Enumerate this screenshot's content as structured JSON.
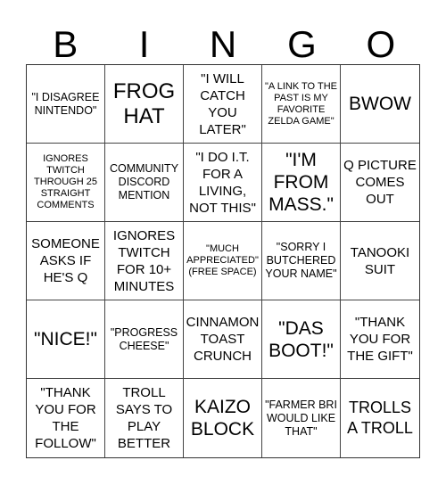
{
  "header": {
    "letters": [
      "B",
      "I",
      "N",
      "G",
      "O"
    ]
  },
  "cells": [
    {
      "text": "\"I DISAGREE NINTENDO\"",
      "size": "s2"
    },
    {
      "text": "FROG HAT",
      "size": "s6"
    },
    {
      "text": "\"I WILL CATCH YOU LATER\"",
      "size": "s3"
    },
    {
      "text": "\"A LINK TO THE PAST IS MY FAVORITE ZELDA GAME\"",
      "size": "s1"
    },
    {
      "text": "BWOW",
      "size": "s5"
    },
    {
      "text": "IGNORES TWITCH THROUGH 25 STRAIGHT COMMENTS",
      "size": "s1"
    },
    {
      "text": "COMMUNITY DISCORD MENTION",
      "size": "s2"
    },
    {
      "text": "\"I DO I.T. FOR A LIVING, NOT THIS\"",
      "size": "s3"
    },
    {
      "text": "\"I'M FROM MASS.\"",
      "size": "s5"
    },
    {
      "text": "Q PICTURE COMES OUT",
      "size": "s3"
    },
    {
      "text": "SOMEONE ASKS IF HE'S Q",
      "size": "s3"
    },
    {
      "text": "IGNORES TWITCH FOR 10+ MINUTES",
      "size": "s3"
    },
    {
      "text": "\"MUCH APPRECIATED\" (FREE SPACE)",
      "size": "s1"
    },
    {
      "text": "\"SORRY I BUTCHERED YOUR NAME\"",
      "size": "s2"
    },
    {
      "text": "TANOOKI SUIT",
      "size": "s3"
    },
    {
      "text": "\"NICE!\"",
      "size": "s5"
    },
    {
      "text": "\"PROGRESS CHEESE\"",
      "size": "s2"
    },
    {
      "text": "CINNAMON TOAST CRUNCH",
      "size": "s3"
    },
    {
      "text": "\"DAS BOOT!\"",
      "size": "s5"
    },
    {
      "text": "\"THANK YOU FOR THE GIFT\"",
      "size": "s3"
    },
    {
      "text": "\"THANK YOU FOR THE FOLLOW\"",
      "size": "s3"
    },
    {
      "text": "TROLL SAYS TO PLAY BETTER",
      "size": "s3"
    },
    {
      "text": "KAIZO BLOCK",
      "size": "s5"
    },
    {
      "text": "\"FARMER BRI WOULD LIKE THAT\"",
      "size": "s2"
    },
    {
      "text": "TROLLS A TROLL",
      "size": "s4"
    }
  ]
}
